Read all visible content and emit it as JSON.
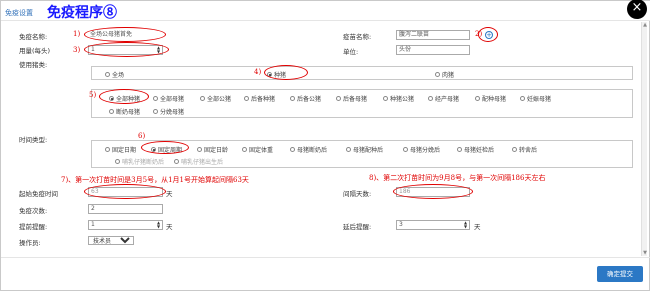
{
  "window": {
    "title_small": "免疫设置",
    "title_big": "免疫程序⑧",
    "close_label": "×"
  },
  "form": {
    "immune_name_label": "免疫名称:",
    "immune_name_value": "全场公母猪首免",
    "vaccine_name_label": "疫苗名称:",
    "vaccine_name_value": "腹泻二联苗",
    "dosage_label": "用量(每头)",
    "dosage_value": "1",
    "unit_label": "单位:",
    "unit_value": "头份",
    "pig_type_label": "使用猪类:",
    "time_type_label": "时间类型:",
    "start_time_label": "起始免疫时间",
    "start_time_value": "63",
    "start_time_unit": "天",
    "interval_label": "间隔天数:",
    "interval_value": "186",
    "immune_count_label": "免疫次数:",
    "immune_count_value": "2",
    "advance_remind_label": "提前提醒:",
    "advance_remind_value": "1",
    "advance_remind_unit": "天",
    "delay_remind_label": "延后提醒:",
    "delay_remind_value": "3",
    "delay_remind_unit": "天",
    "operator_label": "操作员:",
    "operator_value": "技术员"
  },
  "pig_type_options": {
    "all": "全场",
    "breeding": "种猪",
    "fattening": "肉猪"
  },
  "breeding_options": [
    "全部种猪",
    "全部母猪",
    "全部公猪",
    "后备种猪",
    "后备公猪",
    "后备母猪",
    "种猪公猪",
    "经产母猪",
    "配种母猪",
    "妊娠母猪",
    "断奶母猪",
    "分娩母猪"
  ],
  "time_type_options": [
    "固定日期",
    "固定周期",
    "固定日龄",
    "固定体重",
    "母猪断奶后",
    "母猪配种后",
    "母猪分娩后",
    "母猪妊检后",
    "转舍后"
  ],
  "time_type_disabled": [
    "哺乳仔猪断奶后",
    "哺乳仔猪出生后"
  ],
  "annotations": {
    "a1": "1)",
    "a2": "2)",
    "a3": "3)",
    "a4": "4)",
    "a5": "5)",
    "a6": "6)",
    "a7": "7)、第一次打苗时间是3月5号，从1月1号开始算起间隔63天",
    "a8": "8)、第二次打苗时间为9月8号，与第一次间隔186天左右"
  },
  "buttons": {
    "confirm": "确定提交"
  },
  "colors": {
    "annotation_red": "#e00000",
    "title_blue": "#1a1aff",
    "button_blue": "#2b78c5"
  }
}
